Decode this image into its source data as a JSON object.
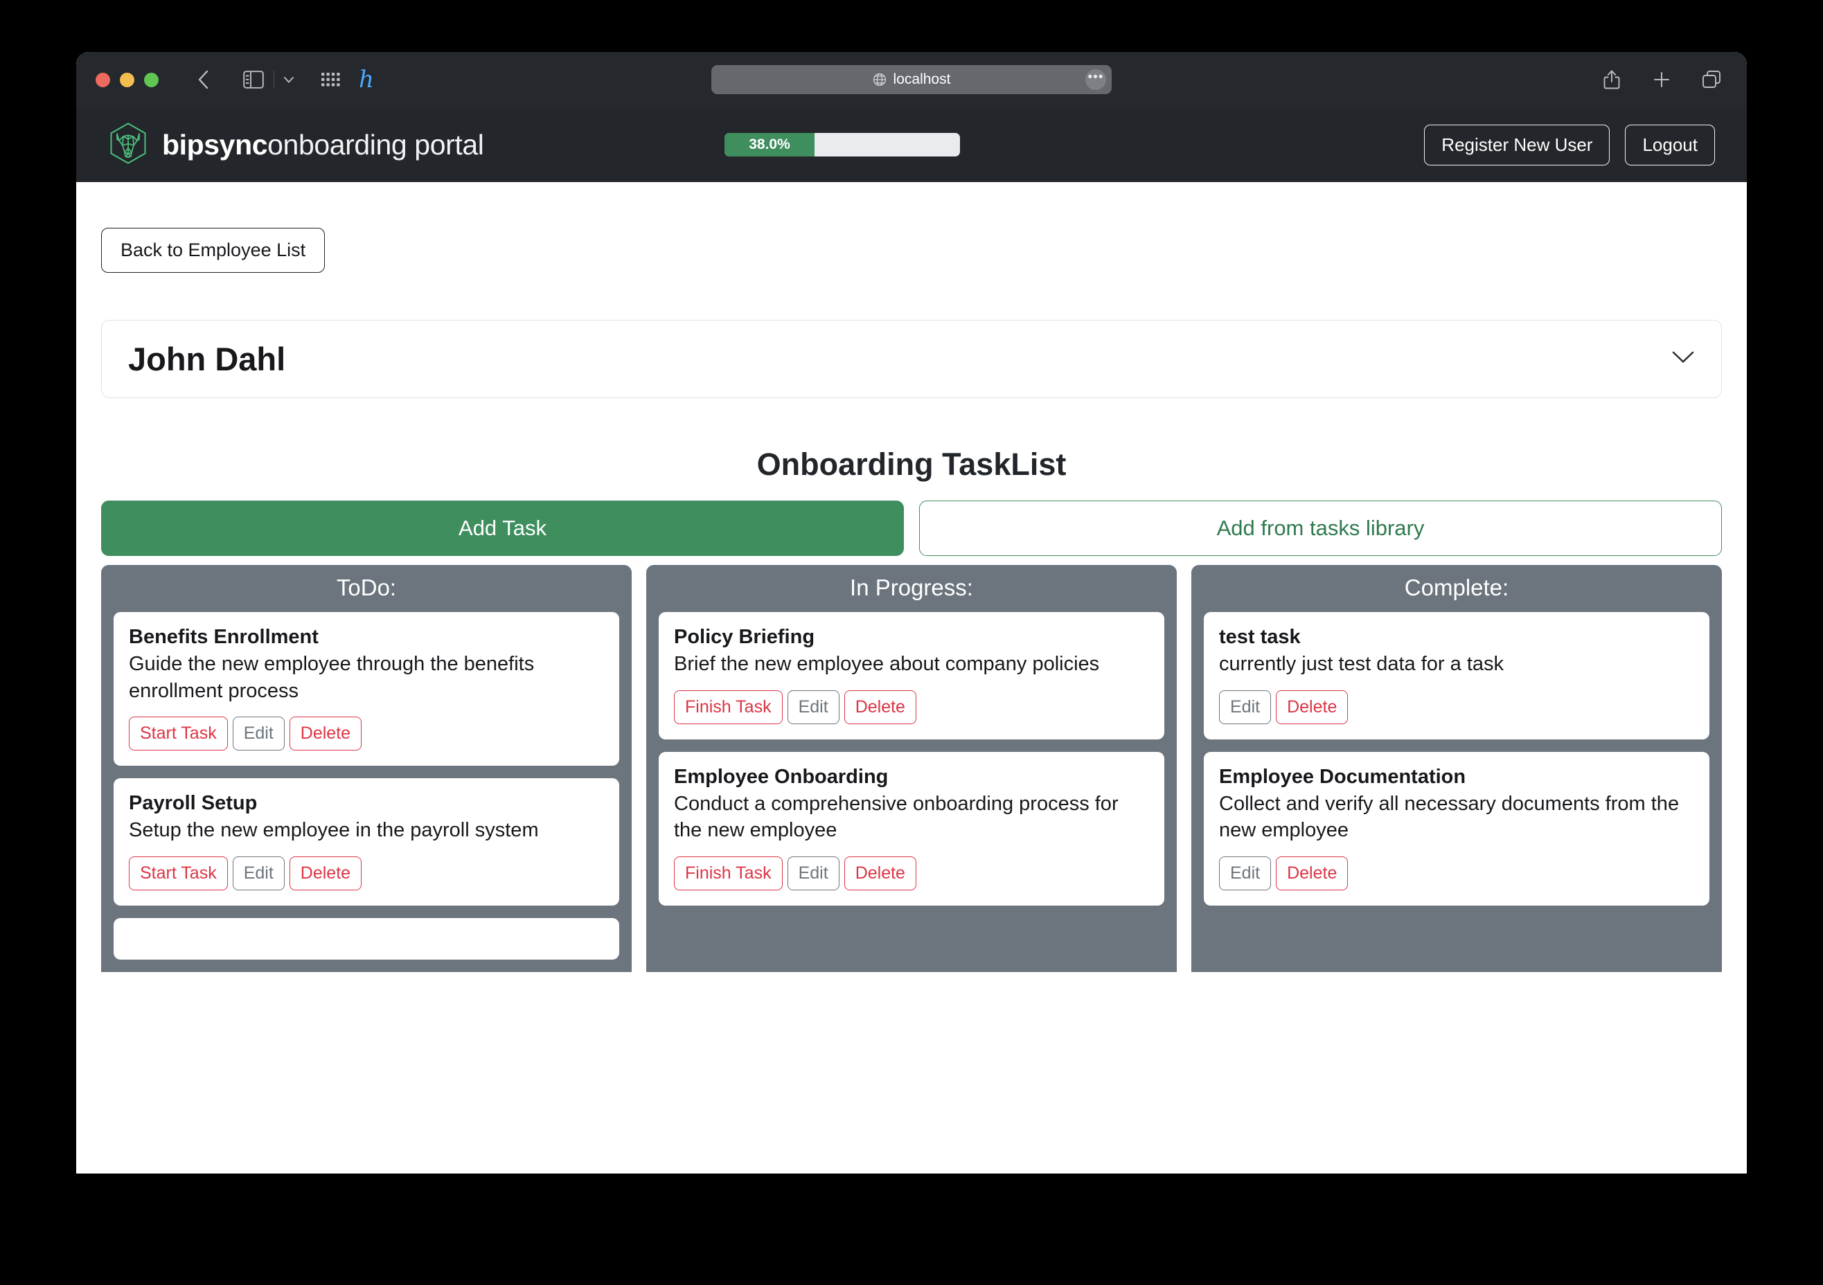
{
  "browser": {
    "url": "localhost",
    "icons": {
      "back": "back-chevron-icon",
      "sidebar": "sidebar-toggle-icon",
      "sidebar_dropdown": "chevron-down-icon",
      "grid": "grid-apps-icon",
      "extension": "hypothesis-extension-icon",
      "globe": "globe-icon",
      "ellipsis": "ellipsis-icon",
      "share": "share-icon",
      "new_tab": "plus-icon",
      "tab_overview": "tab-overview-icon"
    }
  },
  "app_header": {
    "brand_bold": "bipsync",
    "brand_light": "onboarding portal",
    "logo": "bipsync-bull-hexagon-logo",
    "progress_label": "38.0%",
    "progress_percent": 38.0,
    "register_label": "Register New User",
    "logout_label": "Logout"
  },
  "colors": {
    "accent_green": "#3e8e5e",
    "header_dark": "#23262a",
    "column_gray": "#6c757d",
    "danger_red": "#dc3545",
    "neutral_gray": "#6c757d"
  },
  "page": {
    "back_button": "Back to Employee List",
    "employee_name": "John Dahl",
    "tasklist_title": "Onboarding TaskList",
    "add_task_label": "Add Task",
    "add_from_library_label": "Add from tasks library"
  },
  "board": {
    "columns": [
      {
        "title": "ToDo:",
        "cards": [
          {
            "title": "Benefits Enrollment",
            "desc": "Guide the new employee through the benefits enrollment process",
            "primary_action": "Start Task",
            "edit": "Edit",
            "delete": "Delete"
          },
          {
            "title": "Payroll Setup",
            "desc": "Setup the new employee in the payroll system",
            "primary_action": "Start Task",
            "edit": "Edit",
            "delete": "Delete"
          },
          {
            "title": "",
            "desc": "",
            "primary_action": "",
            "edit": "",
            "delete": ""
          }
        ]
      },
      {
        "title": "In Progress:",
        "cards": [
          {
            "title": "Policy Briefing",
            "desc": "Brief the new employee about company policies",
            "primary_action": "Finish Task",
            "edit": "Edit",
            "delete": "Delete"
          },
          {
            "title": "Employee Onboarding",
            "desc": "Conduct a comprehensive onboarding process for the new employee",
            "primary_action": "Finish Task",
            "edit": "Edit",
            "delete": "Delete"
          }
        ]
      },
      {
        "title": "Complete:",
        "cards": [
          {
            "title": "test task",
            "desc": "currently just test data for a task",
            "primary_action": "",
            "edit": "Edit",
            "delete": "Delete"
          },
          {
            "title": "Employee Documentation",
            "desc": "Collect and verify all necessary documents from the new employee",
            "primary_action": "",
            "edit": "Edit",
            "delete": "Delete"
          }
        ]
      }
    ]
  }
}
